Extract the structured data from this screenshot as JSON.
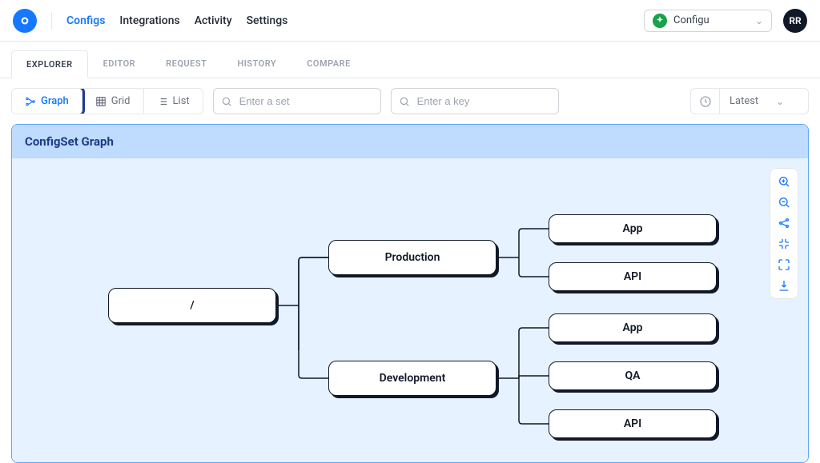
{
  "header": {
    "nav": [
      "Configs",
      "Integrations",
      "Activity",
      "Settings"
    ],
    "active_nav": "Configs",
    "org_name": "Configu",
    "avatar_initials": "RR"
  },
  "subtabs": {
    "items": [
      "EXPLORER",
      "EDITOR",
      "REQUEST",
      "HISTORY",
      "COMPARE"
    ],
    "active": "EXPLORER"
  },
  "toolbar": {
    "views": {
      "graph": "Graph",
      "grid": "Grid",
      "list": "List",
      "active": "Graph"
    },
    "set_placeholder": "Enter a set",
    "key_placeholder": "Enter a key",
    "history_label": "Latest"
  },
  "panel": {
    "title": "ConfigSet Graph"
  },
  "graph": {
    "root": "/",
    "level1": [
      "Production",
      "Development"
    ],
    "production_children": [
      "App",
      "API"
    ],
    "development_children": [
      "App",
      "QA",
      "API"
    ]
  },
  "graph_tools": [
    "zoom-in-icon",
    "zoom-out-icon",
    "share-icon",
    "collapse-icon",
    "expand-icon",
    "download-icon"
  ]
}
